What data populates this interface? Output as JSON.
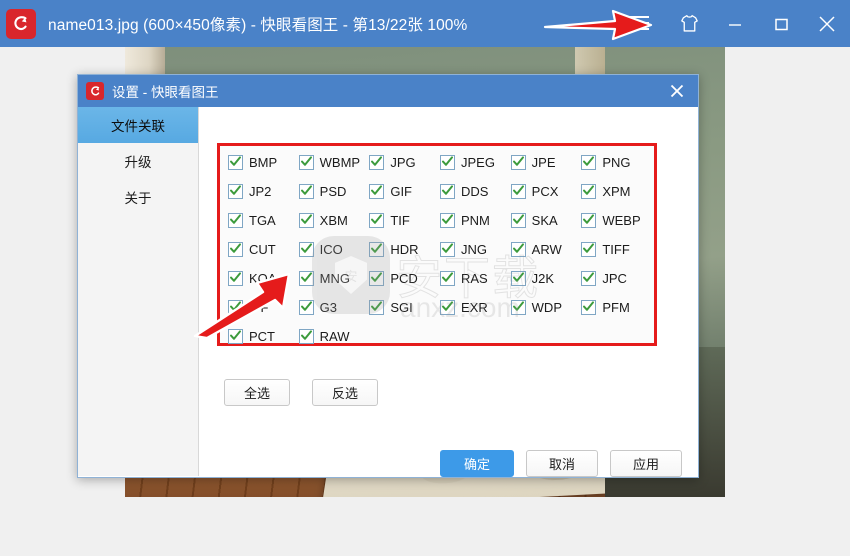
{
  "main_window": {
    "title": "name013.jpg  (600×450像素)  - 快眼看图王 - 第13/22张 100%",
    "filename": "name013.jpg",
    "dimensions": "600×450像素",
    "app_name": "快眼看图王",
    "page_indicator": "第13/22张",
    "zoom_level": "100%",
    "logo_icon": "app-logo-icon",
    "controls": {
      "menu": "hamburger-menu-icon",
      "skin": "shirt-skin-icon",
      "minimize": "minimize-icon",
      "maximize": "maximize-icon",
      "close": "close-icon"
    },
    "accent_color": "#4a82c8"
  },
  "dialog": {
    "title": "设置 - 快眼看图王",
    "logo_icon": "app-logo-icon",
    "close_icon": "close-icon",
    "sidebar": {
      "items": [
        {
          "label": "文件关联",
          "active": true
        },
        {
          "label": "升级",
          "active": false
        },
        {
          "label": "关于",
          "active": false
        }
      ]
    },
    "file_associations": {
      "highlight_color": "#e51b1b",
      "checkbox_check_color": "#3c9b3c",
      "checkbox_border_color": "#7fa6c4",
      "formats": [
        {
          "label": "BMP",
          "checked": true
        },
        {
          "label": "WBMP",
          "checked": true
        },
        {
          "label": "JPG",
          "checked": true
        },
        {
          "label": "JPEG",
          "checked": true
        },
        {
          "label": "JPE",
          "checked": true
        },
        {
          "label": "PNG",
          "checked": true
        },
        {
          "label": "JP2",
          "checked": true
        },
        {
          "label": "PSD",
          "checked": true
        },
        {
          "label": "GIF",
          "checked": true
        },
        {
          "label": "DDS",
          "checked": true
        },
        {
          "label": "PCX",
          "checked": true
        },
        {
          "label": "XPM",
          "checked": true
        },
        {
          "label": "TGA",
          "checked": true
        },
        {
          "label": "XBM",
          "checked": true
        },
        {
          "label": "TIF",
          "checked": true
        },
        {
          "label": "PNM",
          "checked": true
        },
        {
          "label": "SKA",
          "checked": true
        },
        {
          "label": "WEBP",
          "checked": true
        },
        {
          "label": "CUT",
          "checked": true
        },
        {
          "label": "ICO",
          "checked": true
        },
        {
          "label": "HDR",
          "checked": true
        },
        {
          "label": "JNG",
          "checked": true
        },
        {
          "label": "ARW",
          "checked": true
        },
        {
          "label": "TIFF",
          "checked": true
        },
        {
          "label": "KOA",
          "checked": true
        },
        {
          "label": "MNG",
          "checked": true
        },
        {
          "label": "PCD",
          "checked": true
        },
        {
          "label": "RAS",
          "checked": true
        },
        {
          "label": "J2K",
          "checked": true
        },
        {
          "label": "JPC",
          "checked": true
        },
        {
          "label": "IFF",
          "checked": true
        },
        {
          "label": "G3",
          "checked": true
        },
        {
          "label": "SGI",
          "checked": true
        },
        {
          "label": "EXR",
          "checked": true
        },
        {
          "label": "WDP",
          "checked": true
        },
        {
          "label": "PFM",
          "checked": true
        },
        {
          "label": "PCT",
          "checked": true
        },
        {
          "label": "RAW",
          "checked": true
        }
      ]
    },
    "selection_buttons": {
      "select_all": "全选",
      "invert": "反选"
    },
    "action_buttons": {
      "ok": "确定",
      "cancel": "取消",
      "apply": "应用",
      "primary_color": "#3d9ae8"
    }
  },
  "watermark": {
    "cn_text": "安下载",
    "url_text": "anxz.com",
    "badge_text": "安"
  },
  "annotations": {
    "arrow_color": "#e51b1b",
    "arrow_titlebar": "arrow-pointing-to-menu-button",
    "arrow_checkbox": "arrow-pointing-to-format-list"
  }
}
